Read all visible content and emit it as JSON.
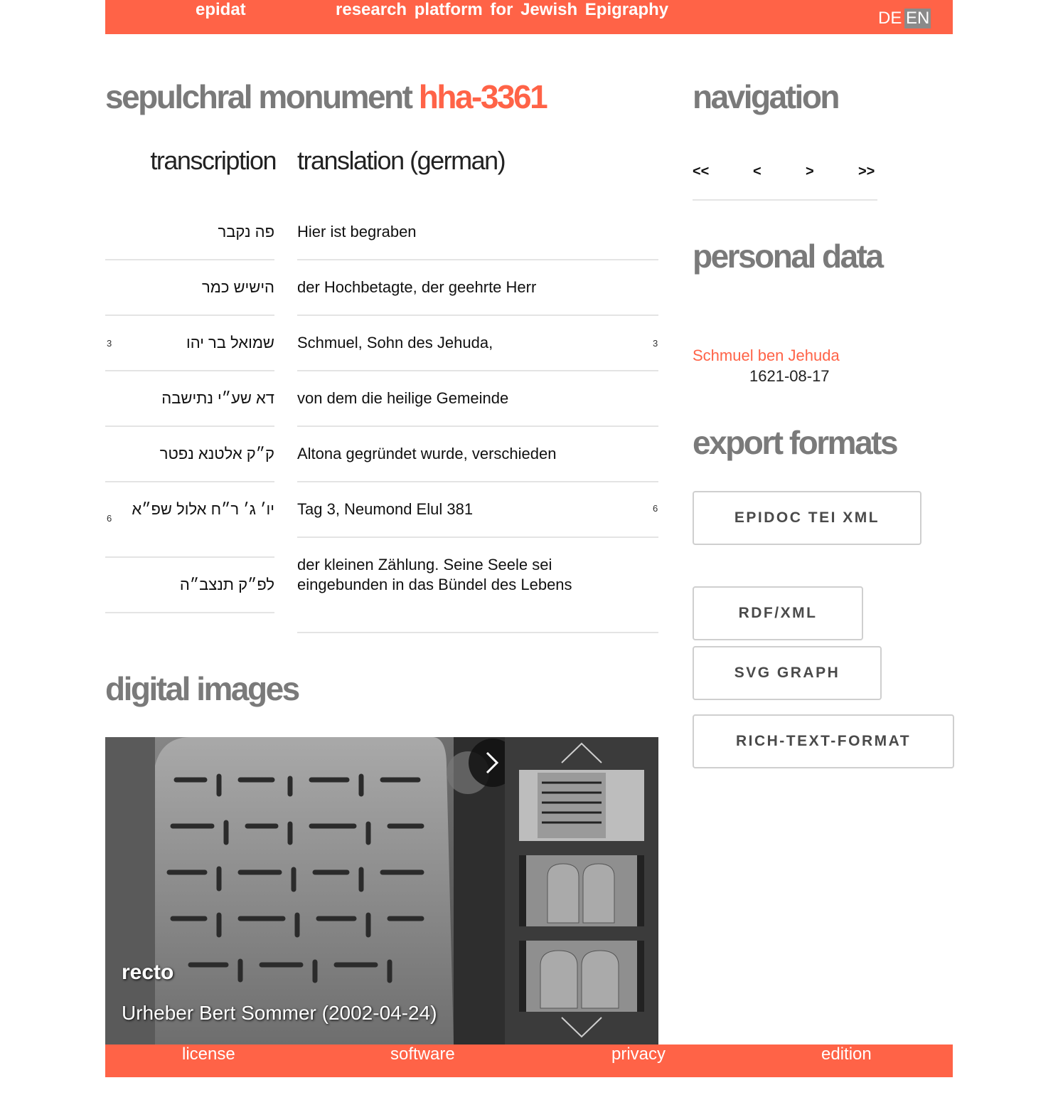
{
  "header": {
    "brand": "epidat",
    "tagline": "research platform for Jewish Epigraphy",
    "lang_de": "DE",
    "lang_en": "EN"
  },
  "title": {
    "prefix": "sepulchral monument ",
    "id": "hha-3361"
  },
  "columns": {
    "transcription": "transcription",
    "translation": "translation (german)"
  },
  "rows": [
    {
      "hebrew": "פה נקבר",
      "german": "Hier ist begraben",
      "line_no": ""
    },
    {
      "hebrew": "הישיש כמר",
      "german": "der Hochbetagte, der geehrte Herr",
      "line_no": ""
    },
    {
      "hebrew": "שמואל בר יהו",
      "german": "Schmuel, Sohn des Jehuda,",
      "line_no": "3"
    },
    {
      "hebrew": "דא שע״י נתישבה",
      "german": "von dem die heilige Gemeinde",
      "line_no": ""
    },
    {
      "hebrew": "ק״ק אלטנא נפטר",
      "german": "Altona gegründet wurde, verschieden",
      "line_no": ""
    },
    {
      "hebrew": "יו׳ ג׳ ר״ח אלול שפ״א",
      "german": "Tag 3, Neumond Elul 381",
      "line_no": "6"
    },
    {
      "hebrew": "לפ״ק תנצב״ה",
      "german": "der kleinen Zählung. Seine Seele sei eingebunden in das Bündel des Lebens",
      "line_no": ""
    }
  ],
  "digital_images": {
    "heading": "digital images",
    "caption": "recto",
    "credit": "Urheber Bert Sommer (2002-04-24)"
  },
  "navigation": {
    "heading": "navigation",
    "first": "<<",
    "prev": "<",
    "next": ">",
    "last": ">>"
  },
  "personal_data": {
    "heading": "personal data",
    "name": "Schmuel ben Jehuda",
    "date": "1621-08-17"
  },
  "export_formats": {
    "heading": "export formats",
    "epidoc": "EPIDOC TEI XML",
    "rdf": "RDF/XML",
    "svg": "SVG GRAPH",
    "rtf": "RICH-TEXT-FORMAT"
  },
  "footer": {
    "license": "license",
    "software": "software",
    "privacy": "privacy",
    "edition": "edition"
  },
  "colors": {
    "accent": "#ff6347",
    "heading_gray": "#7a7a7a",
    "thumb_panel": "#3b3b3b"
  },
  "icons": [
    "chevron-right-icon",
    "chevron-up-icon",
    "chevron-down-icon"
  ]
}
